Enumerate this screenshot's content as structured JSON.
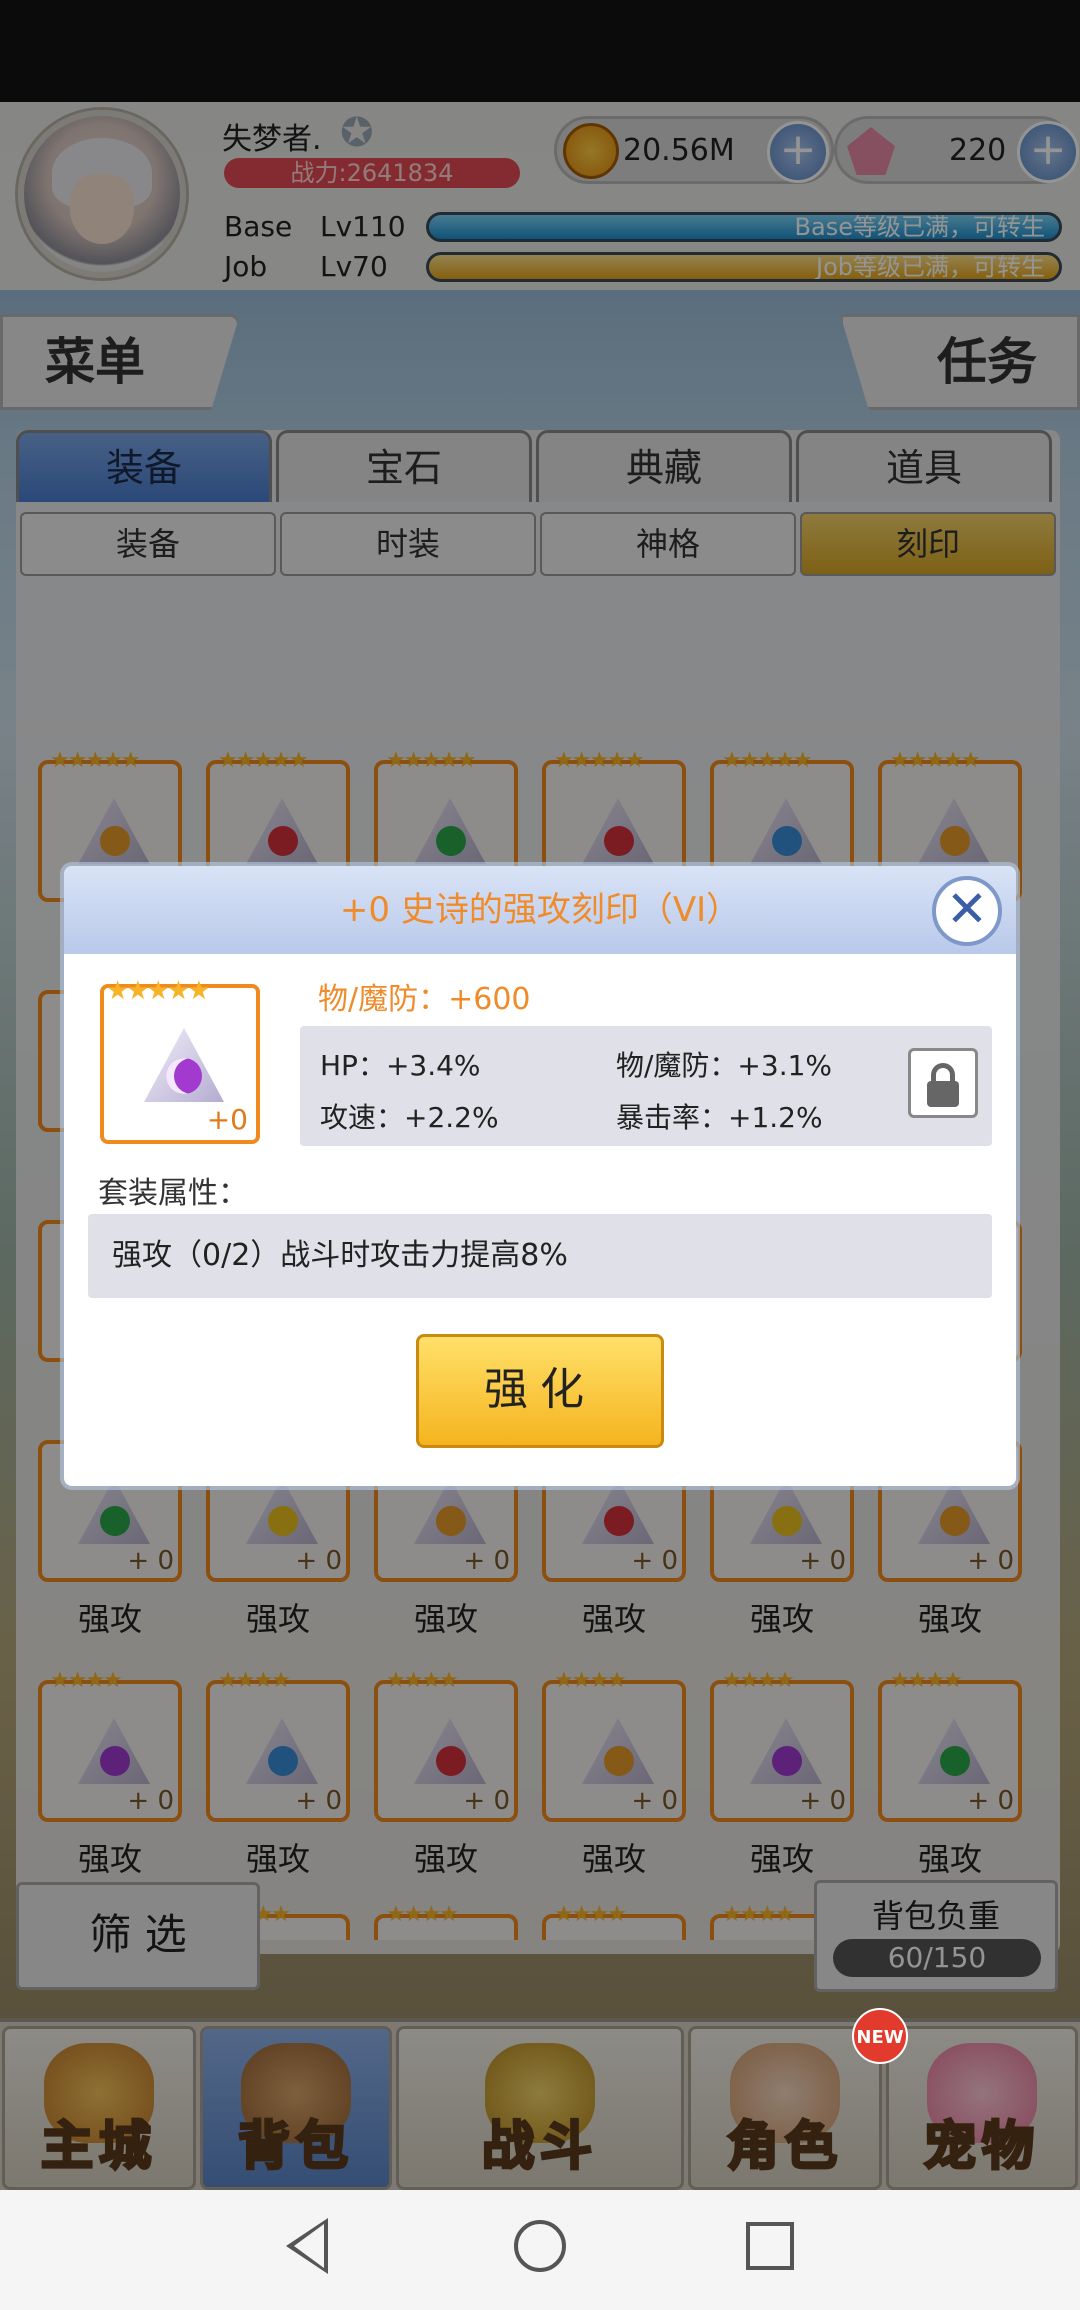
{
  "player": {
    "name": "失梦者.",
    "power": "战力:2641834",
    "base_label": "Base",
    "base_level": "Lv110",
    "base_status": "Base等级已满，可转生",
    "job_label": "Job",
    "job_level": "Lv70",
    "job_status": "Job等级已满，可转生"
  },
  "currency": {
    "zeny": "20.56M",
    "gems": "220"
  },
  "side": {
    "menu": "菜单",
    "tasks": "任务"
  },
  "tabs": [
    "装备",
    "宝石",
    "典藏",
    "道具"
  ],
  "subtabs": [
    "装备",
    "时装",
    "神格",
    "刻印"
  ],
  "grid_label": "强攻",
  "grid_plus": "+ 0",
  "filter_label": "筛 选",
  "bag": {
    "title": "背包负重",
    "value": "60/150"
  },
  "nav": [
    "主城",
    "背包",
    "战斗",
    "角色",
    "宠物"
  ],
  "new_badge": "NEW",
  "modal": {
    "title": "+0 史诗的强攻刻印（VI）",
    "close": "✕",
    "item_plus": "+0",
    "main_stat": "物/魔防：+600",
    "stats": [
      "HP：+3.4%",
      "物/魔防：+3.1%",
      "攻速：+2.2%",
      "暴击率：+1.2%"
    ],
    "set_label": "套装属性：",
    "set_text": "强攻（0/2）战斗时攻击力提高8%",
    "enhance": "强化"
  },
  "colors": {
    "accent": "#f08b2a",
    "tab_active": "#4a7ed0",
    "subtab_active": "#d9a626",
    "card_border": "#f08a1c"
  }
}
